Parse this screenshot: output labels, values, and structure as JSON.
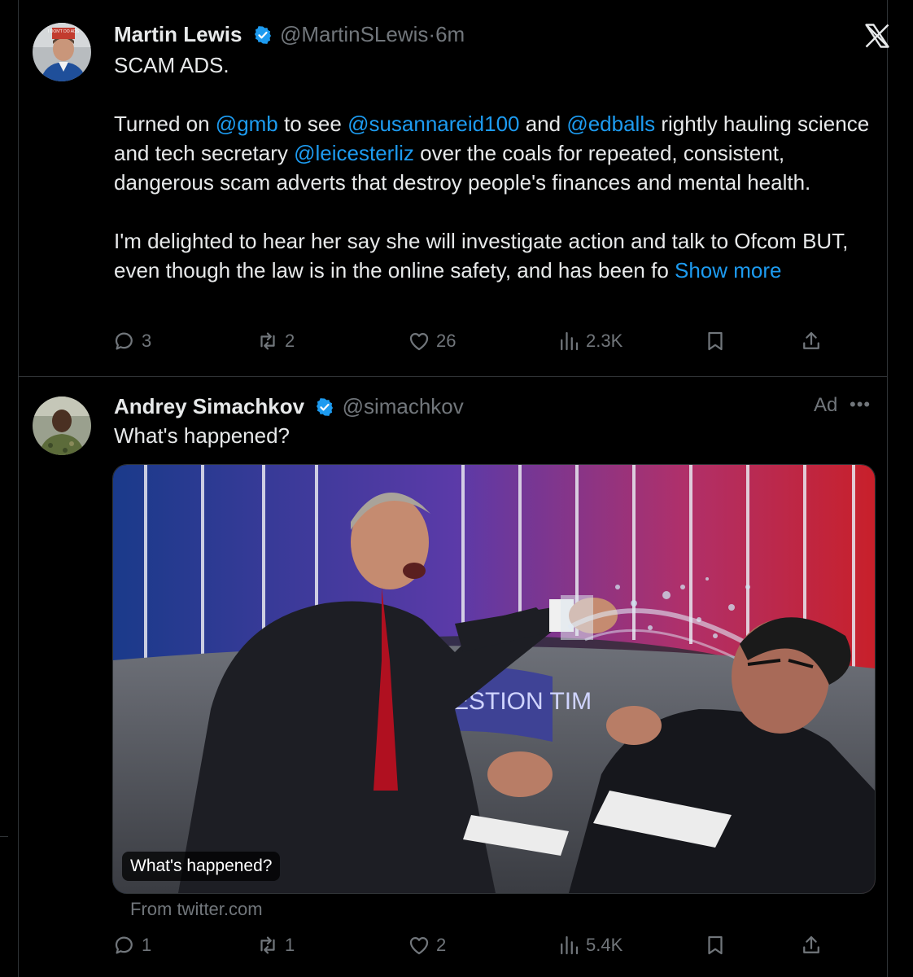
{
  "tweet1": {
    "name": "Martin Lewis",
    "handle": "@MartinSLewis",
    "separator": "·",
    "time": "6m",
    "line1": "SCAM ADS.",
    "para2": {
      "t1": "Turned on ",
      "m1": "@gmb",
      "t2": " to see ",
      "m2": "@susannareid100",
      "t3": " and ",
      "m3": "@edballs",
      "t4": " rightly hauling science and tech secretary ",
      "m4": "@leicesterliz",
      "t5": " over the coals for repeated, consistent, dangerous scam adverts that destroy people's finances and mental health."
    },
    "para3": "I'm delighted to hear her say she will investigate action and talk to Ofcom BUT, even though the law is in the online safety, and has been fo ",
    "show_more": "Show more",
    "avatar_badge": "I DON'T DO ADS",
    "stats": {
      "replies": "3",
      "reposts": "2",
      "likes": "26",
      "views": "2.3K"
    }
  },
  "tweet2": {
    "name": "Andrey Simachkov",
    "handle": "@simachkov",
    "text": "What's happened?",
    "ad_label": "Ad",
    "more": "•••",
    "caption": "What's happened?",
    "source": "From twitter.com",
    "image_text": "QUESTION TIM",
    "stats": {
      "replies": "1",
      "reposts": "1",
      "likes": "2",
      "views": "5.4K"
    }
  },
  "colors": {
    "accent": "#1d9bf0",
    "muted": "#71767b",
    "text": "#e7e9ea",
    "border": "#2f3336"
  },
  "icons": [
    "x-logo-icon",
    "verified-badge-icon",
    "reply-icon",
    "repost-icon",
    "like-icon",
    "views-icon",
    "bookmark-icon",
    "share-icon"
  ]
}
